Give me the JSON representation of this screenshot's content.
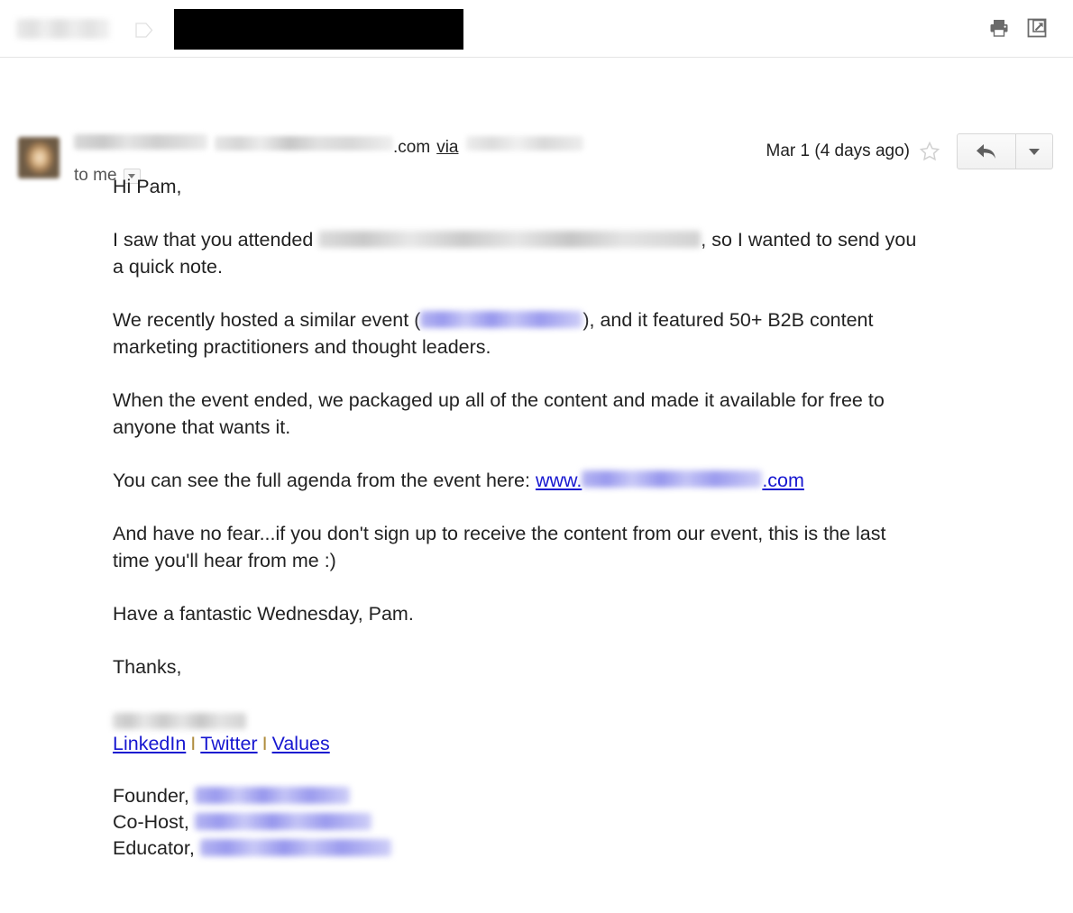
{
  "toolbar": {
    "label_redacted": "",
    "tag_icon": "label-tag-icon",
    "subject_redacted": "",
    "print_icon": "print-icon",
    "popout_icon": "open-in-new-window-icon"
  },
  "message_header": {
    "avatar_alt": "sender-avatar",
    "sender_name_redacted": "",
    "sender_email_redacted": "",
    "email_domain_suffix": ".com",
    "via_label": "via",
    "via_domain_redacted": "",
    "recipients": "to me",
    "recipients_caret_icon": "chevron-down-icon",
    "date": "Mar 1 (4 days ago)",
    "star_icon": "star-icon",
    "reply_icon": "reply-arrow-icon",
    "more_icon": "chevron-down-icon"
  },
  "body": {
    "greeting": "Hi Pam,",
    "p1_before": "I saw that you attended ",
    "p1_redacted": "",
    "p1_after": ", so I wanted to send you a quick note.",
    "p2_before": "We recently hosted a similar event (",
    "p2_redacted": "",
    "p2_after": "), and it featured 50+ B2B content marketing practitioners and thought leaders.",
    "p3": "When the event ended, we packaged up all of the content and made it available for free to anyone that wants it.",
    "p4_before": "You can see the full agenda from the event here: ",
    "p4_link_prefix": "www.",
    "p4_link_redacted": "",
    "p4_link_suffix": ".com",
    "p5": "And have no fear...if you don't sign up to receive the content from our event, this is the last time you'll hear from me :)",
    "p6": "Have a fantastic Wednesday, Pam.",
    "p7": "Thanks,"
  },
  "signature": {
    "name_redacted": "",
    "link_linkedin": "LinkedIn",
    "link_twitter": "Twitter",
    "link_values": "Values",
    "separator": "I",
    "role1_label": "Founder,",
    "role1_redacted": "",
    "role2_label": "Co-Host,",
    "role2_redacted": "",
    "role3_label": "Educator,",
    "role3_redacted": ""
  },
  "colors": {
    "link_blue": "#1717d0",
    "redaction_black": "#000000",
    "divider_gray": "#e4e4e4",
    "text": "#222222"
  }
}
